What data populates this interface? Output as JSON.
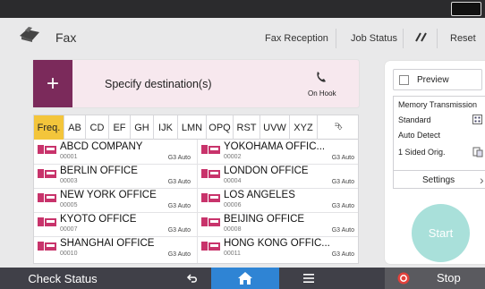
{
  "header": {
    "app_title": "Fax",
    "app_icon": "fax-icon",
    "buttons": {
      "fax_reception": "Fax Reception",
      "job_status": "Job Status",
      "reset": "Reset"
    }
  },
  "destination": {
    "label": "Specify destination(s)",
    "plus": "+",
    "on_hook_label": "On Hook"
  },
  "tabs": [
    "Freq.",
    "AB",
    "CD",
    "EF",
    "GH",
    "IJK",
    "LMN",
    "OPQ",
    "RST",
    "UVW",
    "XYZ",
    "⮷"
  ],
  "active_tab": "Freq.",
  "entries": [
    {
      "name": "ABCD COMPANY",
      "number": "00001",
      "type": "G3 Auto"
    },
    {
      "name": "YOKOHAMA OFFIC...",
      "number": "00002",
      "type": "G3 Auto"
    },
    {
      "name": "BERLIN OFFICE",
      "number": "00003",
      "type": "G3 Auto"
    },
    {
      "name": "LONDON OFFICE",
      "number": "00004",
      "type": "G3 Auto"
    },
    {
      "name": "NEW YORK OFFICE",
      "number": "00005",
      "type": "G3 Auto"
    },
    {
      "name": "LOS ANGELES",
      "number": "00006",
      "type": "G3 Auto"
    },
    {
      "name": "KYOTO OFFICE",
      "number": "00007",
      "type": "G3 Auto"
    },
    {
      "name": "BEIJING OFFICE",
      "number": "00008",
      "type": "G3 Auto"
    },
    {
      "name": "SHANGHAI OFFICE",
      "number": "00010",
      "type": "G3 Auto"
    },
    {
      "name": "HONG KONG OFFIC...",
      "number": "00011",
      "type": "G3 Auto"
    }
  ],
  "right_panel": {
    "preview_label": "Preview",
    "memory_transmission": "Memory Transmission",
    "standard": "Standard",
    "auto_detect": "Auto Detect",
    "one_sided": "1 Sided Orig.",
    "settings": "Settings",
    "start": "Start"
  },
  "bottom_bar": {
    "check_status": "Check Status",
    "stop": "Stop"
  },
  "colors": {
    "accent_purple": "#7b2a5b",
    "active_tab": "#f3c53b",
    "home_blue": "#2f84d4",
    "start_teal": "#a9e0da",
    "stop_red": "#e2413b"
  }
}
